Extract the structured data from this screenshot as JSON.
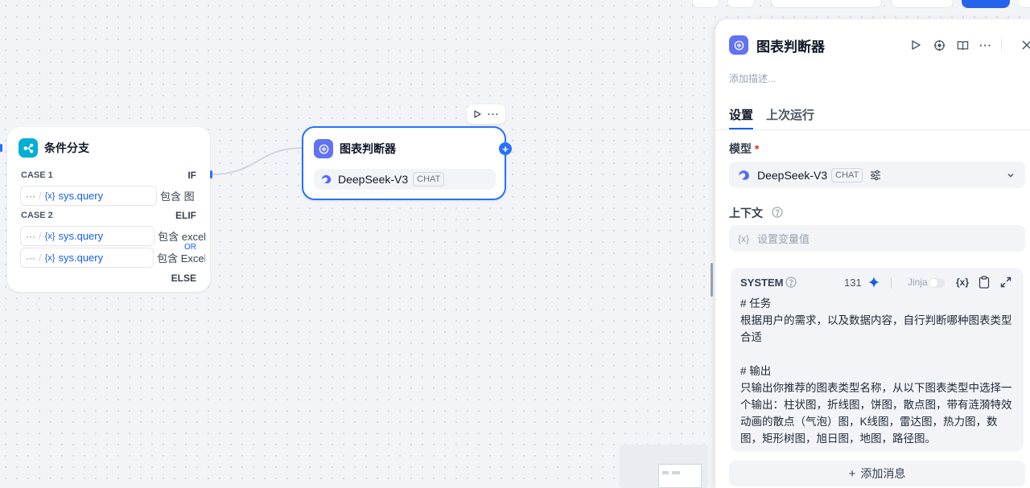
{
  "canvas": {
    "branch_node": {
      "title": "条件分支",
      "cases": [
        {
          "label": "CASE 1",
          "keyword": "IF",
          "conditions": [
            {
              "variable": "sys.query",
              "operator": "包含 图"
            }
          ]
        },
        {
          "label": "CASE 2",
          "keyword": "ELIF",
          "logic": "OR",
          "conditions": [
            {
              "variable": "sys.query",
              "operator": "包含 excel"
            },
            {
              "variable": "sys.query",
              "operator": "包含 Excel"
            }
          ]
        }
      ],
      "else_label": "ELSE"
    },
    "llm_node": {
      "title": "图表判断器",
      "model_name": "DeepSeek-V3",
      "model_tag": "CHAT"
    }
  },
  "panel": {
    "title": "图表判断器",
    "description_placeholder": "添加描述...",
    "tabs": [
      "设置",
      "上次运行"
    ],
    "active_tab": 0,
    "model_label": "模型",
    "required_mark": "*",
    "model_name": "DeepSeek-V3",
    "model_tag": "CHAT",
    "context_label": "上下文",
    "context_placeholder": "设置变量值",
    "context_icon_text": "{x}",
    "system": {
      "label": "SYSTEM",
      "count": "131",
      "jinja_label": "Jinja",
      "var_icon_text": "{x}",
      "prompt": "# 任务\n根据用户的需求，以及数据内容，自行判断哪种图表类型合适\n\n# 输出\n只输出你推荐的图表类型名称，从以下图表类型中选择一个输出：柱状图，折线图，饼图，散点图，带有涟漪特效动画的散点（气泡）图，K线图，雷达图，热力图，数图，矩形树图，旭日图，地图，路径图。"
    },
    "add_message_label": "添加消息",
    "add_message_plus": "+"
  },
  "colors": {
    "primary": "#155eef",
    "branch_icon_bg": "#06aed4",
    "llm_icon_bg": "#6172f3",
    "selected_border": "#2970ff",
    "canvas_bg": "#f2f4f7"
  }
}
